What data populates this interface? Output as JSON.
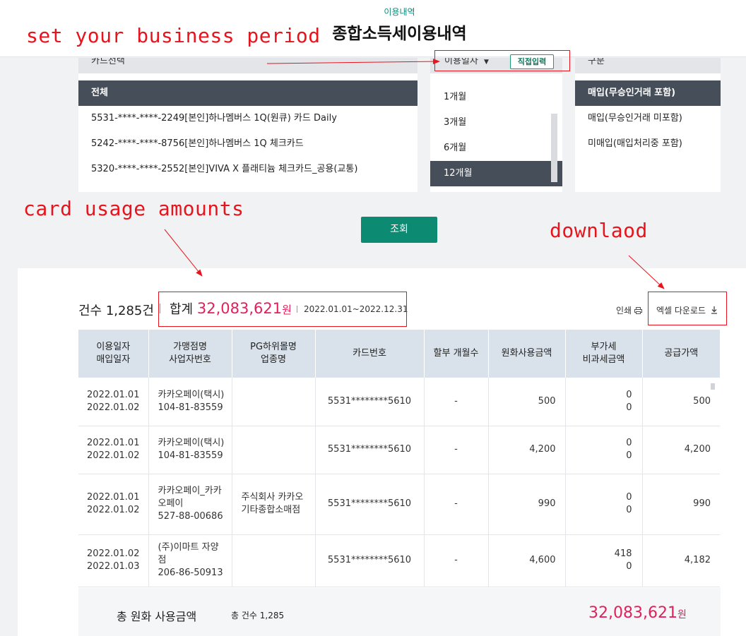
{
  "header": {
    "breadcrumb": "이용내역",
    "title": "종합소득세이용내역"
  },
  "annotations": {
    "period": "set your business period",
    "usage": "card usage amounts",
    "download": "downlaod"
  },
  "card_panel": {
    "header": "카드선택",
    "items": [
      {
        "label": "전체",
        "active": true
      },
      {
        "label": "5531-****-****-2249[본인]하나멤버스 1Q(원큐) 카드 Daily",
        "active": false
      },
      {
        "label": "5242-****-****-8756[본인]하나멤버스 1Q 체크카드",
        "active": false
      },
      {
        "label": "5320-****-****-2552[본인]VIVA X 플래티늄 체크카드_공용(교통)",
        "active": false
      }
    ]
  },
  "period_panel": {
    "header": "이용일자",
    "direct_input": "직접입력",
    "items": [
      {
        "label": "1개월",
        "active": false
      },
      {
        "label": "3개월",
        "active": false
      },
      {
        "label": "6개월",
        "active": false
      },
      {
        "label": "12개월",
        "active": true
      }
    ]
  },
  "type_panel": {
    "header": "구분",
    "items": [
      {
        "label": "매입(무승인거래 포함)",
        "active": true
      },
      {
        "label": "매입(무승인거래 미포함)",
        "active": false
      },
      {
        "label": "미매입(매입처리중 포함)",
        "active": false
      }
    ]
  },
  "search_label": "조회",
  "summary": {
    "count": "건수 1,285건",
    "total_label": "합계",
    "total_amount": "32,083,621",
    "won": "원",
    "period": "2022.01.01~2022.12.31",
    "print": "인쇄",
    "excel": "엑셀 다운로드"
  },
  "table": {
    "headers": [
      [
        "이용일자",
        "매입일자"
      ],
      [
        "가맹점명",
        "사업자번호"
      ],
      [
        "PG하위몰명",
        "업종명"
      ],
      [
        "카드번호"
      ],
      [
        "할부 개월수"
      ],
      [
        "원화사용금액"
      ],
      [
        "부가세",
        "비과세금액"
      ],
      [
        "공급가액"
      ]
    ],
    "rows": [
      {
        "date1": "2022.01.01",
        "date2": "2022.01.02",
        "merchant": [
          "카카오페이(택시)",
          "104-81-83559"
        ],
        "pg": [],
        "card": "5531********5610",
        "installment": "-",
        "amount": "500",
        "vat": "0",
        "taxfree": "0",
        "supply": "500"
      },
      {
        "date1": "2022.01.01",
        "date2": "2022.01.02",
        "merchant": [
          "카카오페이(택시)",
          "104-81-83559"
        ],
        "pg": [],
        "card": "5531********5610",
        "installment": "-",
        "amount": "4,200",
        "vat": "0",
        "taxfree": "0",
        "supply": "4,200"
      },
      {
        "date1": "2022.01.01",
        "date2": "2022.01.02",
        "merchant": [
          "카카오페이_카카",
          "오페이",
          "527-88-00686"
        ],
        "pg": [
          "주식회사 카카오",
          "기타종합소매점"
        ],
        "card": "5531********5610",
        "installment": "-",
        "amount": "990",
        "vat": "0",
        "taxfree": "0",
        "supply": "990"
      },
      {
        "date1": "2022.01.02",
        "date2": "2022.01.03",
        "merchant": [
          "(주)이마트 자양",
          "점",
          "206-86-50913"
        ],
        "pg": [],
        "card": "5531********5610",
        "installment": "-",
        "amount": "4,600",
        "vat": "418",
        "taxfree": "0",
        "supply": "4,182"
      }
    ]
  },
  "footer": {
    "label": "총 원화 사용금액",
    "count": "총 건수 1,285",
    "amount": "32,083,621",
    "won": "원"
  },
  "colors": {
    "accent": "#0d8a72",
    "highlight": "#e2205a",
    "annotation": "#e8141d",
    "active_bg": "#464e5a"
  }
}
